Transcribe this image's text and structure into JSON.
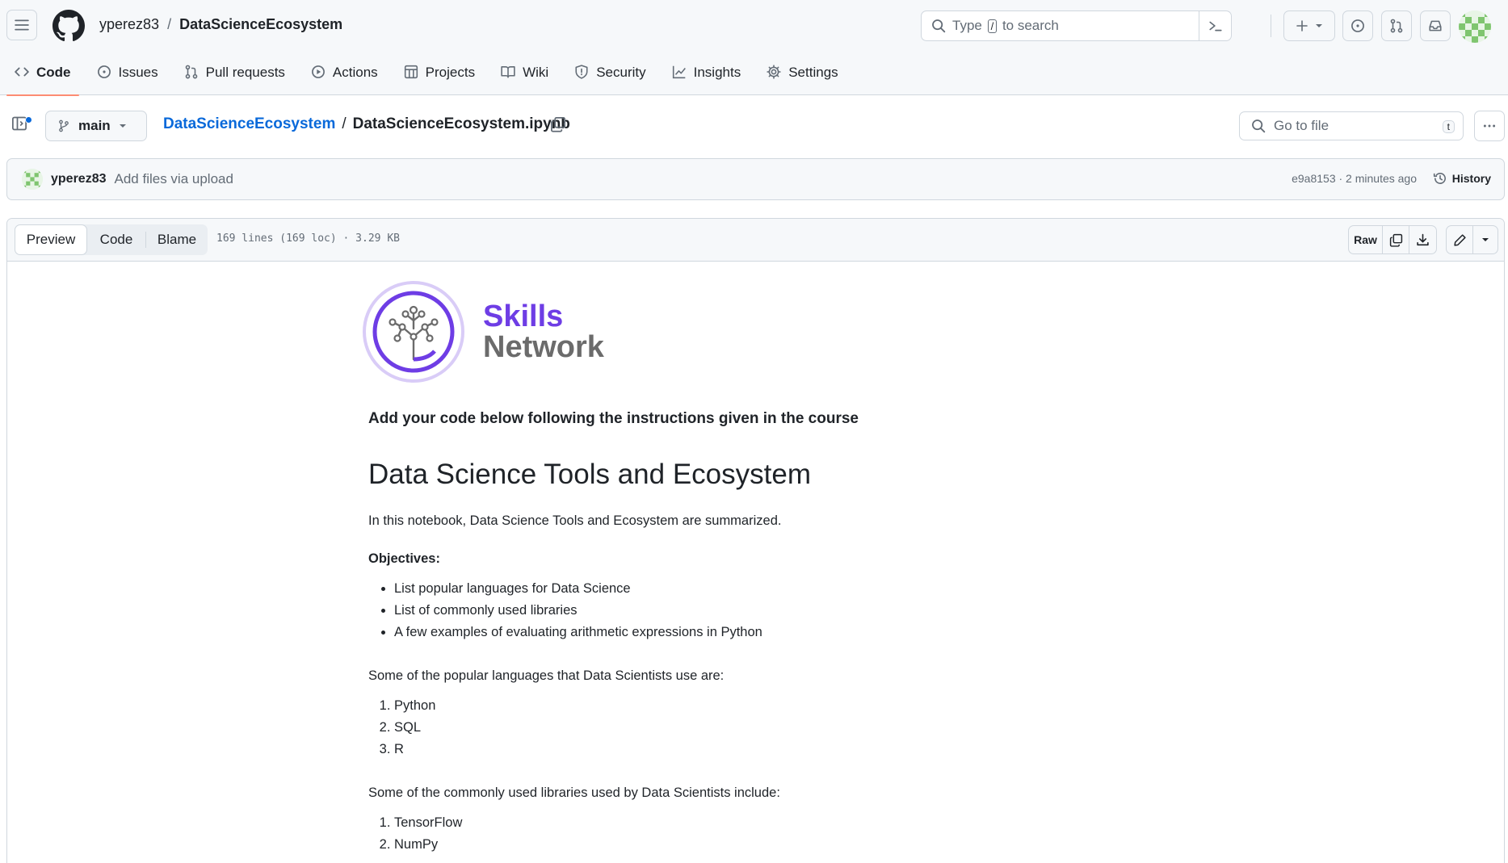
{
  "header": {
    "owner": "yperez83",
    "separator": "/",
    "repo": "DataScienceEcosystem",
    "search": {
      "prefix": "Type",
      "key": "/",
      "suffix": "to search"
    }
  },
  "repo_nav": [
    {
      "label": "Code",
      "icon": "code-icon",
      "active": true
    },
    {
      "label": "Issues",
      "icon": "issue-icon"
    },
    {
      "label": "Pull requests",
      "icon": "pull-request-icon"
    },
    {
      "label": "Actions",
      "icon": "play-icon"
    },
    {
      "label": "Projects",
      "icon": "table-icon"
    },
    {
      "label": "Wiki",
      "icon": "book-icon"
    },
    {
      "label": "Security",
      "icon": "shield-icon"
    },
    {
      "label": "Insights",
      "icon": "graph-icon"
    },
    {
      "label": "Settings",
      "icon": "gear-icon"
    }
  ],
  "file_bar": {
    "branch": "main",
    "repo_link": "DataScienceEcosystem",
    "sep": "/",
    "file_name": "DataScienceEcosystem.ipynb",
    "goto_placeholder": "Go to file",
    "goto_key": "t"
  },
  "commit": {
    "author": "yperez83",
    "message": "Add files via upload",
    "meta": "e9a8153 · 2 minutes ago",
    "history_label": "History"
  },
  "viewer": {
    "tabs": [
      "Preview",
      "Code",
      "Blame"
    ],
    "file_info": "169 lines (169 loc) · 3.29 KB",
    "raw_label": "Raw"
  },
  "notebook": {
    "logo_line1": "Skills",
    "logo_line2": "Network",
    "lead": "Add your code below following the instructions given in the course",
    "title": "Data Science Tools and Ecosystem",
    "intro": "In this notebook, Data Science Tools and Ecosystem are summarized.",
    "objectives_label": "Objectives:",
    "objectives": [
      "List popular languages for Data Science",
      "List of commonly used libraries",
      "A few examples of evaluating arithmetic expressions in Python"
    ],
    "languages_intro": "Some of the popular languages that Data Scientists use are:",
    "languages": [
      "Python",
      "SQL",
      "R"
    ],
    "libraries_intro": "Some of the commonly used libraries used by Data Scientists include:",
    "libraries": [
      "TensorFlow",
      "NumPy"
    ]
  },
  "colors": {
    "link": "#0969da",
    "active_tab_underline": "#fd8c73",
    "logo_purple": "#6e3de5"
  }
}
